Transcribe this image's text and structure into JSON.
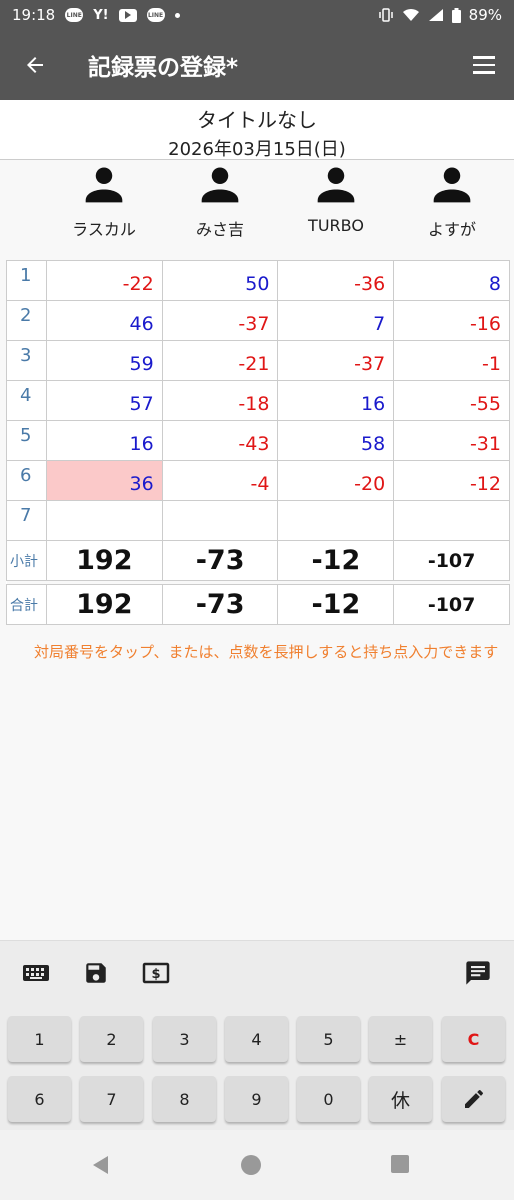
{
  "status": {
    "time": "19:18",
    "battery": "89%",
    "icons": [
      "line-icon",
      "yahoo-icon",
      "youtube-icon",
      "line-icon",
      "dot-icon"
    ],
    "right_icons": [
      "vibrate-icon",
      "wifi-icon",
      "signal-icon",
      "battery-icon"
    ]
  },
  "appbar": {
    "title": "記録票の登録*",
    "back_icon": "arrow-left-icon",
    "menu_icon": "hamburger-icon"
  },
  "header": {
    "title": "タイトルなし",
    "date": "2026年03月15日(日)"
  },
  "players": [
    {
      "name": "ラスカル"
    },
    {
      "name": "みさ吉"
    },
    {
      "name": "TURBO"
    },
    {
      "name": "よすが"
    }
  ],
  "rounds": [
    {
      "no": "1",
      "scores": [
        "-22",
        "50",
        "-36",
        "8"
      ]
    },
    {
      "no": "2",
      "scores": [
        "46",
        "-37",
        "7",
        "-16"
      ]
    },
    {
      "no": "3",
      "scores": [
        "59",
        "-21",
        "-37",
        "-1"
      ]
    },
    {
      "no": "4",
      "scores": [
        "57",
        "-18",
        "16",
        "-55"
      ]
    },
    {
      "no": "5",
      "scores": [
        "16",
        "-43",
        "58",
        "-31"
      ]
    },
    {
      "no": "6",
      "scores": [
        "36",
        "-4",
        "-20",
        "-12"
      ]
    },
    {
      "no": "7",
      "scores": [
        "",
        "",
        "",
        ""
      ]
    }
  ],
  "selected_cell": {
    "round": 6,
    "player": 1
  },
  "subtotal": {
    "label": "小計",
    "values": [
      "192",
      "-73",
      "-12",
      "-107"
    ]
  },
  "total": {
    "label": "合計",
    "values": [
      "192",
      "-73",
      "-12",
      "-107"
    ]
  },
  "note": "対局番号をタップ、または、点数を長押しすると持ち点入力できます",
  "toolbar": [
    "keyboard-icon",
    "save-icon",
    "money-icon",
    "comment-icon"
  ],
  "keypad": {
    "row1": [
      "1",
      "2",
      "3",
      "4",
      "5",
      "±",
      "C"
    ],
    "row2": [
      "6",
      "7",
      "8",
      "9",
      "0",
      "休",
      "pencil-icon"
    ]
  },
  "colors": {
    "bar": "#555555",
    "positive": "#1a1acc",
    "negative": "#e01616",
    "selected": "#fbc9c9",
    "note": "#f08030"
  }
}
